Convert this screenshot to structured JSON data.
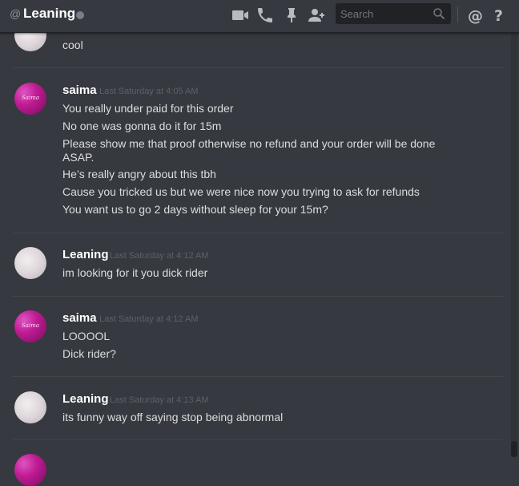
{
  "header": {
    "at_symbol": "@",
    "channel_name": "Leaning",
    "search_placeholder": "Search"
  },
  "messages": [
    {
      "username": "",
      "timestamp": "",
      "lines": [
        "cool"
      ]
    },
    {
      "username": "saima",
      "timestamp": "Last Saturday at 4:05 AM",
      "avatar_text": "Saima",
      "lines": [
        "You really under paid for this order",
        "No one was gonna do it for 15m",
        "Please show me that proof otherwise no refund and your order will be done ASAP.",
        "He’s really angry about this tbh",
        "Cause you tricked us but we were nice now you trying to ask for refunds",
        "You want us to go 2 days without sleep for your 15m?"
      ]
    },
    {
      "username": "Leaning",
      "timestamp": "Last Saturday at 4:12 AM",
      "lines": [
        "im looking for it you dick rider"
      ]
    },
    {
      "username": "saima",
      "timestamp": "Last Saturday at 4:12 AM",
      "avatar_text": "Saima",
      "lines": [
        "LOOOOL",
        "Dick rider?"
      ]
    },
    {
      "username": "Leaning",
      "timestamp": "Last Saturday at 4:13 AM",
      "lines": [
        "its funny way off saying stop being abnormal"
      ]
    }
  ],
  "colors": {
    "background": "#36393f",
    "header_title": "#ffffff",
    "message_text": "#dcddde",
    "timestamp": "#5d6167",
    "icon": "#b9bbbe",
    "status_offline": "#747f8d",
    "saima_avatar": "#c01c93"
  }
}
